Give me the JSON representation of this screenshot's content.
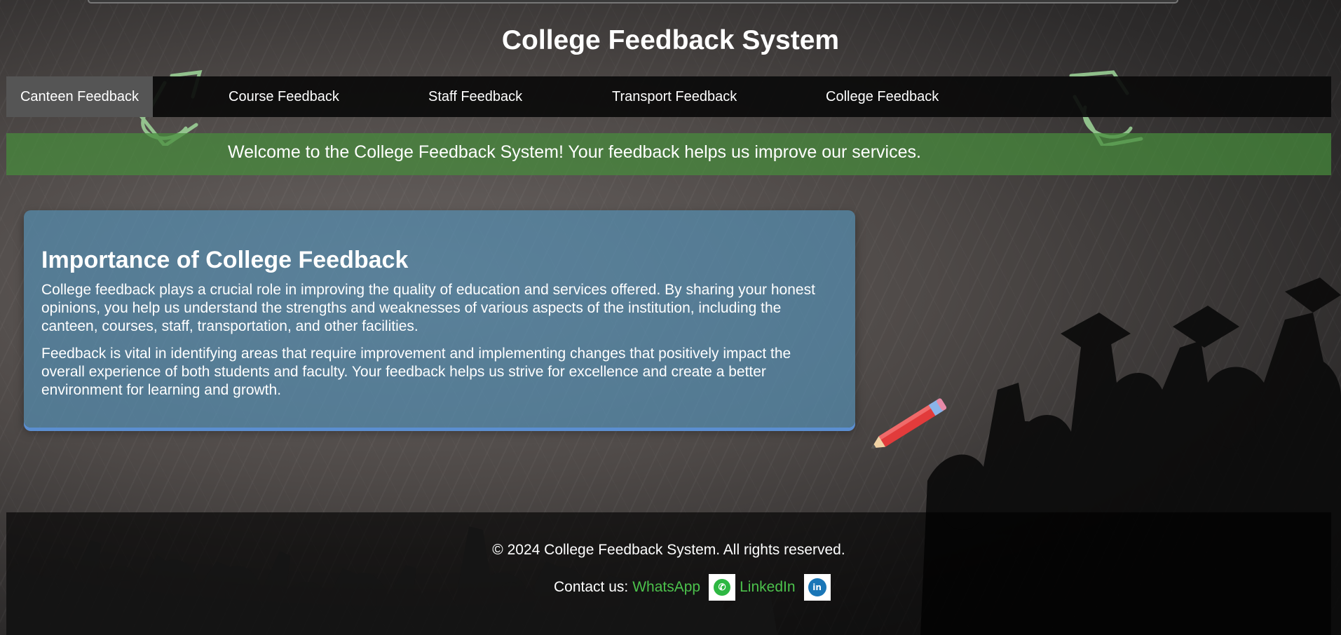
{
  "header": {
    "title": "College Feedback System"
  },
  "nav": {
    "items": [
      {
        "label": "Canteen Feedback",
        "active": true
      },
      {
        "label": "Course Feedback"
      },
      {
        "label": "Staff Feedback"
      },
      {
        "label": "Transport Feedback"
      },
      {
        "label": "College Feedback"
      }
    ]
  },
  "banner": {
    "text": "Welcome to the College Feedback System! Your feedback helps us improve our services."
  },
  "card": {
    "heading": "Importance of College Feedback",
    "paragraphs": [
      "College feedback plays a crucial role in improving the quality of education and services offered. By sharing your honest opinions, you help us understand the strengths and weaknesses of various aspects of the institution, including the canteen, courses, staff, transportation, and other facilities.",
      "Feedback is vital in identifying areas that require improvement and implementing changes that positively impact the overall experience of both students and faculty. Your feedback helps us strive for excellence and create a better environment for learning and growth."
    ]
  },
  "footer": {
    "copyright": "© 2024 College Feedback System. All rights reserved.",
    "contact_label": "Contact us:",
    "whatsapp_label": "WhatsApp",
    "linkedin_label": "LinkedIn"
  },
  "colors": {
    "nav_bg": "#0a0a0a",
    "nav_active": "#555555",
    "banner_bg": "#468c3c",
    "card_bg": "#548caf",
    "link_green": "#4cc24c",
    "whatsapp": "#2db742",
    "linkedin": "#1a76b7"
  },
  "icons": [
    "graduation-cap-icon",
    "pencil-icon",
    "whatsapp-icon",
    "linkedin-icon"
  ]
}
